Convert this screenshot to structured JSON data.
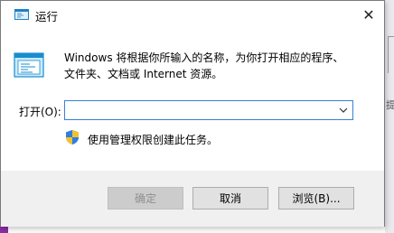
{
  "window": {
    "title": "运行",
    "close_label": "✕"
  },
  "description": {
    "line1": "Windows 将根据你所输入的名称，为你打开相应的程序、",
    "line2": "文件夹、文档或 Internet 资源。"
  },
  "open_field": {
    "label": "打开(O):",
    "value": "",
    "dropdown_icon": "chevron-down-icon"
  },
  "admin_notice": {
    "text": "使用管理权限创建此任务。",
    "icon": "uac-shield-icon"
  },
  "buttons": {
    "ok": "确定",
    "cancel": "取消",
    "browse": "浏览(B)..."
  },
  "background": {
    "right_text": "提"
  },
  "colors": {
    "focus_border": "#3c7fd6",
    "footer_bg": "#f0f0f0",
    "disabled_text": "#8f8f8f"
  }
}
